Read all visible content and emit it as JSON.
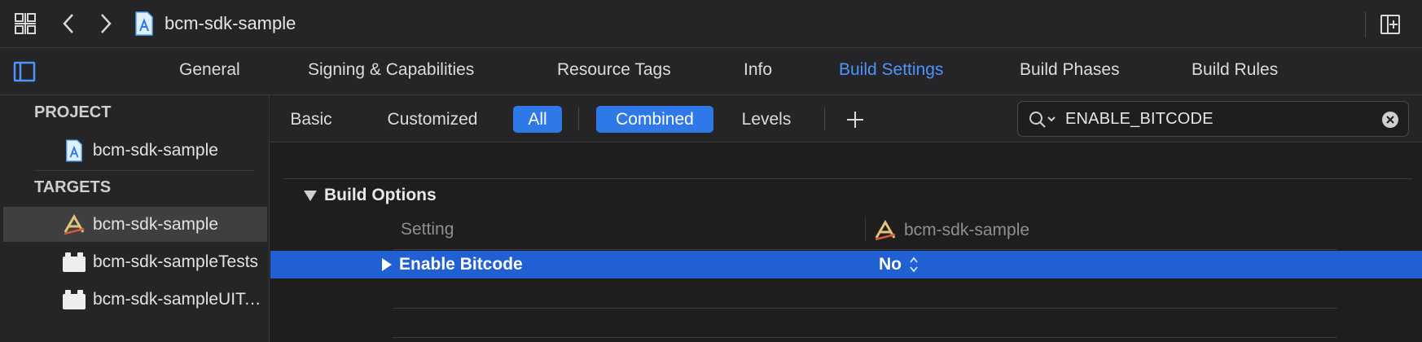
{
  "colors": {
    "accent": "#4d94ff",
    "selection": "#2160d3",
    "toggle_on": "#2f78e8",
    "background": "#1e1e1e",
    "panel": "#252527"
  },
  "toolbar": {
    "grid_icon": "grid-icon",
    "back_icon": "chevron-left-icon",
    "forward_icon": "chevron-right-icon",
    "project_icon": "xcode-project-icon",
    "title": "bcm-sdk-sample",
    "add_editor_icon": "add-editor-icon"
  },
  "tabs": [
    {
      "label": "General",
      "active": false
    },
    {
      "label": "Signing & Capabilities",
      "active": false
    },
    {
      "label": "Resource Tags",
      "active": false
    },
    {
      "label": "Info",
      "active": false
    },
    {
      "label": "Build Settings",
      "active": true
    },
    {
      "label": "Build Phases",
      "active": false
    },
    {
      "label": "Build Rules",
      "active": false
    }
  ],
  "sidebar": {
    "project_header": "PROJECT",
    "project_item": "bcm-sdk-sample",
    "targets_header": "TARGETS",
    "targets": [
      {
        "label": "bcm-sdk-sample",
        "icon": "app-target-icon",
        "selected": true
      },
      {
        "label": "bcm-sdk-sampleTests",
        "icon": "test-bundle-icon",
        "selected": false
      },
      {
        "label": "bcm-sdk-sampleUITests",
        "icon": "test-bundle-icon",
        "selected": false
      }
    ]
  },
  "filters": {
    "basic": "Basic",
    "customized": "Customized",
    "all": "All",
    "combined": "Combined",
    "levels": "Levels",
    "add_icon": "plus-icon"
  },
  "search": {
    "value": "ENABLE_BITCODE",
    "search_icon": "search-icon",
    "clear_icon": "clear-icon"
  },
  "content": {
    "section_title": "Build Options",
    "col_setting": "Setting",
    "col_target": "bcm-sdk-sample",
    "row": {
      "name": "Enable Bitcode",
      "value": "No"
    }
  }
}
